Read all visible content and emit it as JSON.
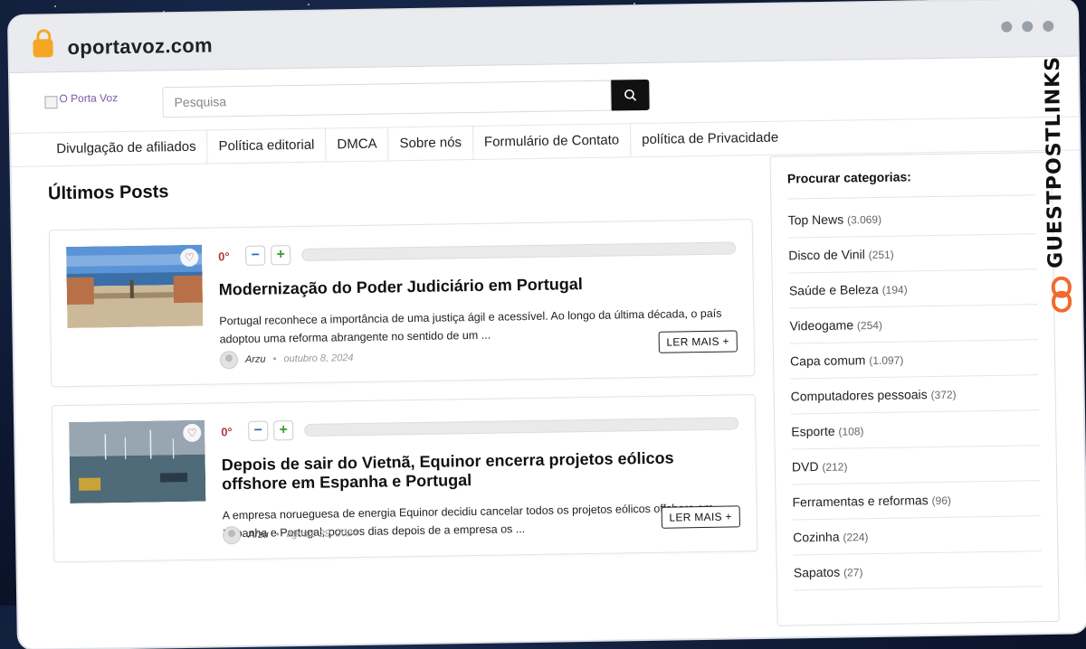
{
  "browser": {
    "url": "oportavoz.com"
  },
  "site": {
    "logo_alt": "O Porta Voz",
    "search": {
      "placeholder": "Pesquisa"
    },
    "nav": [
      "Divulgação de afiliados",
      "Política editorial",
      "DMCA",
      "Sobre nós",
      "Formulário de Contato",
      "política de Privacidade"
    ]
  },
  "main": {
    "section_title": "Últimos Posts",
    "posts": [
      {
        "votes": "0°",
        "title": "Modernização do Poder Judiciário em Portugal",
        "excerpt": "Portugal reconhece a importância de uma justiça ágil e acessível. Ao longo da última década, o país adoptou uma reforma abrangente no sentido de um ...",
        "author": "Arzu",
        "date": "outubro 8, 2024",
        "read_more": "LER MAIS +"
      },
      {
        "votes": "0°",
        "title": "Depois de sair do Vietnã, Equinor encerra projetos eólicos offshore em Espanha e Portugal",
        "excerpt": "A empresa norueguesa de energia Equinor decidiu cancelar todos os projetos eólicos offshore em Espanha e Portugal, poucos dias depois de a empresa os ...",
        "author": "Arzu",
        "date": "agosto 29, 2024",
        "read_more": "LER MAIS +"
      }
    ]
  },
  "sidebar": {
    "title": "Procurar categorias:",
    "categories": [
      {
        "name": "Top News",
        "count": "(3.069)"
      },
      {
        "name": "Disco de Vinil",
        "count": "(251)"
      },
      {
        "name": "Saúde e Beleza",
        "count": "(194)"
      },
      {
        "name": "Videogame",
        "count": "(254)"
      },
      {
        "name": "Capa comum",
        "count": "(1.097)"
      },
      {
        "name": "Computadores pessoais",
        "count": "(372)"
      },
      {
        "name": "Esporte",
        "count": "(108)"
      },
      {
        "name": "DVD",
        "count": "(212)"
      },
      {
        "name": "Ferramentas e reformas",
        "count": "(96)"
      },
      {
        "name": "Cozinha",
        "count": "(224)"
      },
      {
        "name": "Sapatos",
        "count": "(27)"
      }
    ]
  },
  "badge": {
    "text": "GUESTPOSTLINKS",
    "accent": "#f26a2e"
  }
}
